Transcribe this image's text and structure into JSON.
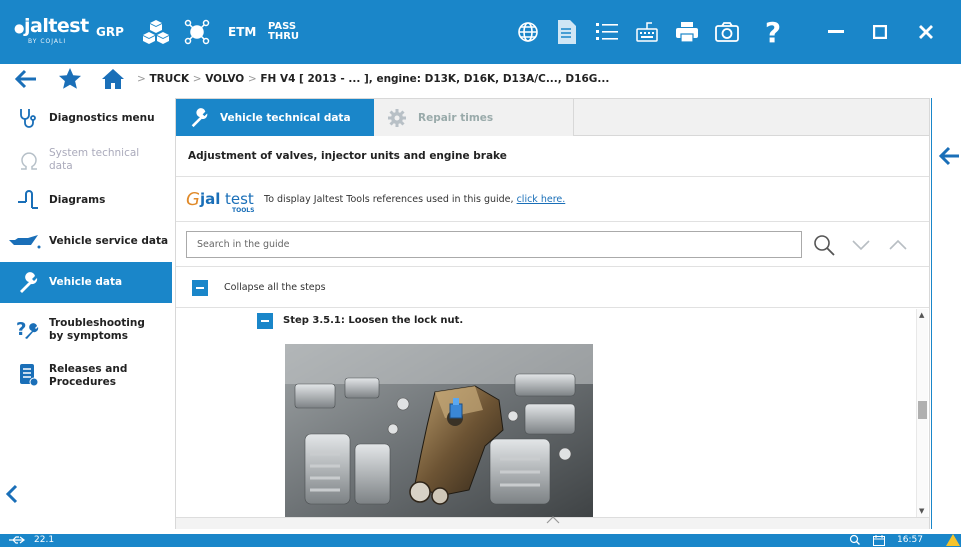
{
  "colors": {
    "primary": "#1a86c9",
    "sidebar_active": "#1a86c9",
    "text_dark": "#222222",
    "disabled_text": "#aaaabb",
    "link": "#1a6fb8",
    "tab_inactive_text": "#99aaaa"
  },
  "topbar": {
    "logo_text": "jaltest",
    "logo_sub": "BY COJALI",
    "modules": [
      "GRP",
      "ETM"
    ],
    "pass_thru": [
      "PASS",
      "THRU"
    ],
    "icons": [
      "globe-icon",
      "document-icon",
      "list-icon",
      "keyboard-icon",
      "printer-icon",
      "camera-icon",
      "help-icon",
      "apps-grid-icon"
    ],
    "window_controls": [
      "minimize-icon",
      "maximize-icon",
      "close-icon"
    ]
  },
  "breadcrumb": {
    "segments": [
      "TRUCK",
      "VOLVO",
      "FH V4 [ 2013 - ... ], engine: D13K, D16K, D13A/C..., D16G..."
    ],
    "separator": ">"
  },
  "sidebar": {
    "items": [
      {
        "label": "Diagnostics menu",
        "icon": "stethoscope-icon",
        "state": "normal"
      },
      {
        "label": "System technical data",
        "icon": "omega-icon",
        "state": "disabled"
      },
      {
        "label": "Diagrams",
        "icon": "diagram-icon",
        "state": "normal"
      },
      {
        "label": "Vehicle service data",
        "icon": "oil-can-icon",
        "state": "normal"
      },
      {
        "label": "Vehicle data",
        "icon": "wrench-icon",
        "state": "active"
      },
      {
        "label": "Troubleshooting by symptoms",
        "icon": "question-wrench-icon",
        "state": "normal"
      },
      {
        "label": "Releases and Procedures",
        "icon": "procedures-icon",
        "state": "normal"
      }
    ]
  },
  "tabs": [
    {
      "label": "Vehicle technical data",
      "icon": "wrench-icon",
      "active": true
    },
    {
      "label": "Repair times",
      "icon": "gear-icon",
      "active": false
    }
  ],
  "guide": {
    "title": "Adjustment of valves, injector units and engine brake",
    "tools_logo": "jaltest",
    "tools_logo_sub": "TOOLS",
    "tools_text": "To display Jaltest Tools references used in this guide,",
    "tools_link": "click here.",
    "search_placeholder": "Search in the guide",
    "collapse_label": "Collapse all the steps",
    "step_label": "Step 3.5.1: Loosen the lock nut."
  },
  "statusbar": {
    "version": "22.1",
    "time": "16:57"
  }
}
